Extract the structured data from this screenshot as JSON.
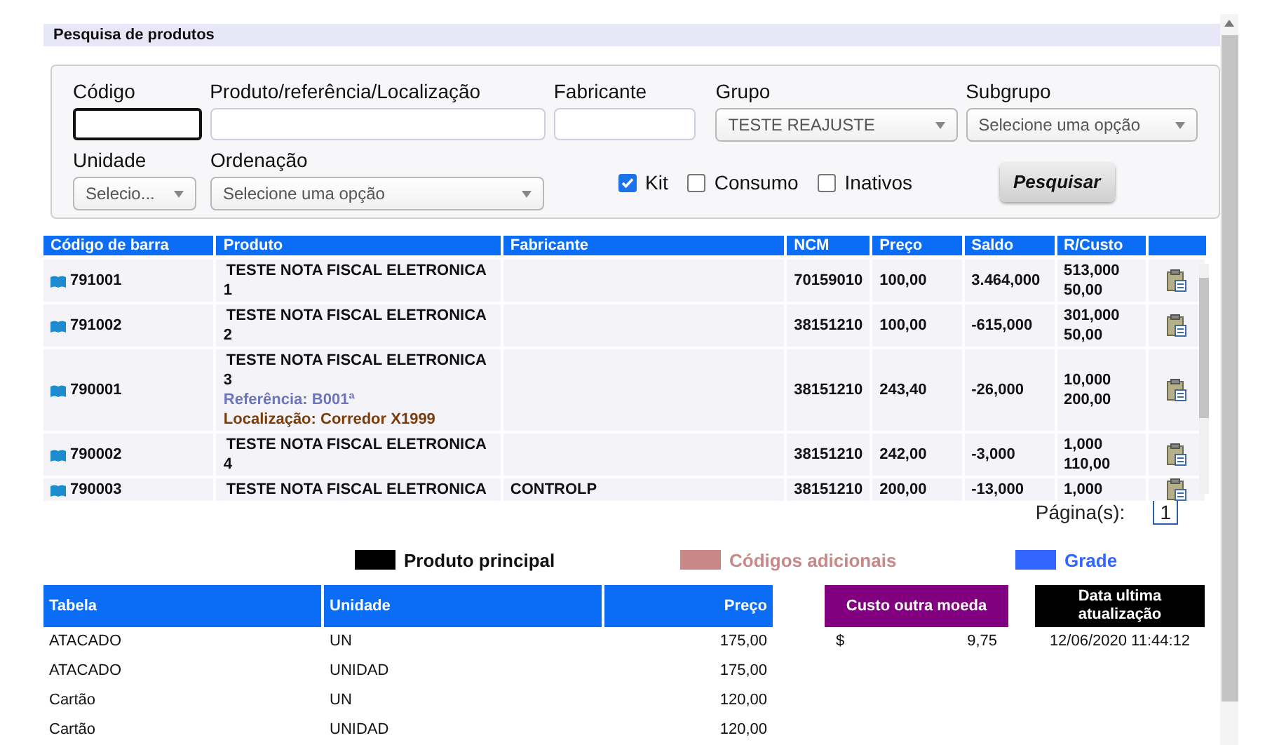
{
  "title": "Pesquisa de produtos",
  "filters": {
    "fields": [
      {
        "kind": "input",
        "label": "Código",
        "focused": true
      },
      {
        "kind": "input",
        "label": "Produto/referência/Localização",
        "focused": false
      },
      {
        "kind": "input",
        "label": "Fabricante",
        "focused": false
      },
      {
        "kind": "select",
        "label": "Grupo",
        "value": "TESTE REAJUSTE"
      },
      {
        "kind": "select",
        "label": "Subgrupo",
        "value": "Selecione uma opção"
      },
      {
        "kind": "select",
        "label": "Unidade",
        "value": "Selecio..."
      },
      {
        "kind": "select",
        "label": "Ordenação",
        "value": "Selecione uma opção"
      }
    ],
    "checkboxes": [
      {
        "label": "Kit",
        "checked": true
      },
      {
        "label": "Consumo",
        "checked": false
      },
      {
        "label": "Inativos",
        "checked": false
      }
    ],
    "search_button": "Pesquisar"
  },
  "table": {
    "columns": [
      "Código de barra",
      "Produto",
      "Fabricante",
      "NCM",
      "Preço",
      "Saldo",
      "R/Custo"
    ],
    "rows": [
      {
        "code": "791001",
        "product": [
          "TESTE NOTA FISCAL ELETRONICA",
          "1"
        ],
        "reference": "",
        "location": "",
        "manufacturer": "",
        "ncm": "70159010",
        "price": "100,00",
        "balance": "3.464,000",
        "cost": [
          "513,000",
          "50,00"
        ]
      },
      {
        "code": "791002",
        "product": [
          "TESTE NOTA FISCAL ELETRONICA",
          "2"
        ],
        "reference": "",
        "location": "",
        "manufacturer": "",
        "ncm": "38151210",
        "price": "100,00",
        "balance": "-615,000",
        "cost": [
          "301,000",
          "50,00"
        ]
      },
      {
        "code": "790001",
        "product": [
          "TESTE NOTA FISCAL ELETRONICA",
          "3"
        ],
        "reference": "Referência: B001ª",
        "location": "Localização: Corredor X1999",
        "manufacturer": "",
        "ncm": "38151210",
        "price": "243,40",
        "balance": "-26,000",
        "cost": [
          "10,000",
          "200,00"
        ]
      },
      {
        "code": "790002",
        "product": [
          "TESTE NOTA FISCAL ELETRONICA",
          "4"
        ],
        "reference": "",
        "location": "",
        "manufacturer": "",
        "ncm": "38151210",
        "price": "242,00",
        "balance": "-3,000",
        "cost": [
          "1,000",
          "110,00"
        ]
      },
      {
        "code": "790003",
        "product": [
          "TESTE NOTA FISCAL ELETRONICA"
        ],
        "reference": "",
        "location": "",
        "manufacturer": "CONTROLP",
        "ncm": "38151210",
        "price": "200,00",
        "balance": "-13,000",
        "cost": [
          "1,000"
        ]
      }
    ]
  },
  "pagination": {
    "label": "Página(s):",
    "pages": [
      {
        "label": "1",
        "selected": true
      }
    ]
  },
  "legend": [
    {
      "label": "Produto principal",
      "color": "#000000"
    },
    {
      "label": "Códigos adicionais",
      "color": "#c88888"
    },
    {
      "label": "Grade",
      "color": "#3366ff"
    }
  ],
  "price_table": {
    "columns": [
      "Tabela",
      "Unidade",
      "Preço"
    ],
    "rows": [
      [
        "ATACADO",
        "UN",
        "175,00"
      ],
      [
        "ATACADO",
        "UNIDAD",
        "175,00"
      ],
      [
        "Cartão",
        "UN",
        "120,00"
      ],
      [
        "Cartão",
        "UNIDAD",
        "120,00"
      ]
    ]
  },
  "other_currency": {
    "header": "Custo outra moeda",
    "symbol": "$",
    "value": "9,75"
  },
  "last_update": {
    "header": "Data ultima atualização",
    "value": "12/06/2020 11:44:12"
  }
}
